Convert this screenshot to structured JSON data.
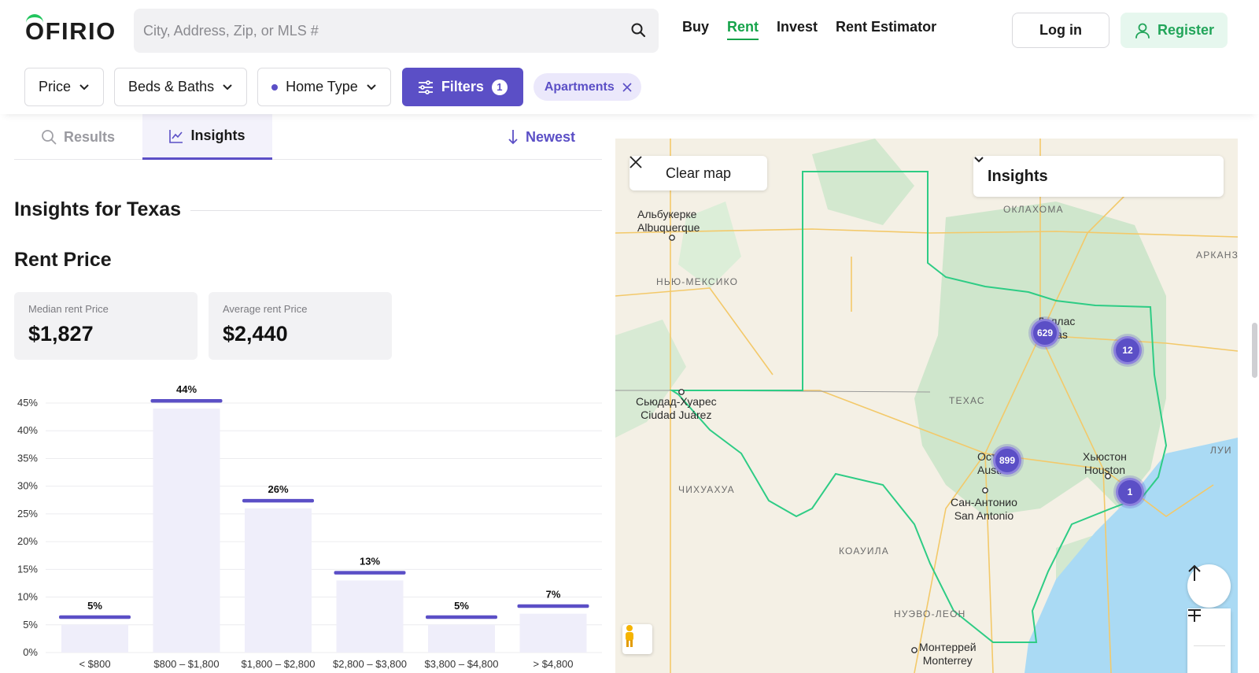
{
  "header": {
    "logo": "OFIRIO",
    "search_placeholder": "City, Address, Zip, or MLS #",
    "nav": [
      "Buy",
      "Rent",
      "Invest",
      "Rent Estimator"
    ],
    "active_nav": "Rent",
    "login": "Log in",
    "register": "Register"
  },
  "filters": {
    "price": "Price",
    "beds_baths": "Beds & Baths",
    "home_type": "Home Type",
    "filters_label": "Filters",
    "filters_count": "1",
    "chip": "Apartments"
  },
  "tabs": {
    "results": "Results",
    "insights": "Insights",
    "sort": "Newest"
  },
  "insights": {
    "title": "Insights for Texas",
    "section": "Rent Price",
    "median_label": "Median rent Price",
    "median_value": "$1,827",
    "average_label": "Average rent Price",
    "average_value": "$2,440"
  },
  "chart_data": {
    "type": "bar",
    "categories": [
      "< $800",
      "$800 – $1,800",
      "$1,800 – $2,800",
      "$2,800 – $3,800",
      "$3,800 – $4,800",
      "> $4,800"
    ],
    "values": [
      5,
      44,
      26,
      13,
      5,
      7
    ],
    "value_labels": [
      "5%",
      "44%",
      "26%",
      "13%",
      "5%",
      "7%"
    ],
    "y_ticks": [
      "0%",
      "5%",
      "10%",
      "15%",
      "20%",
      "25%",
      "30%",
      "35%",
      "40%",
      "45%"
    ],
    "ylim": [
      0,
      45
    ],
    "grid": true,
    "bar_color": "#efeefa",
    "cap_color": "#5b4fc6"
  },
  "map": {
    "clear_map": "Clear map",
    "dropdown": "Insights",
    "labels": {
      "albuquerque_ru": "Альбукерке",
      "albuquerque": "Albuquerque",
      "new_mexico": "НЬЮ-МЕКСИКО",
      "oklahoma": "ОКЛАХОМА",
      "arkansas": "АРКАНЗ",
      "dallas_ru": "Даллас",
      "dallas": "Dallas",
      "texas": "ТЕХАС",
      "juarez_ru": "Сьюдад-Хуарес",
      "juarez": "Ciudad Juárez",
      "austin_ru": "Остин",
      "austin": "Austin",
      "houston_ru": "Хьюстон",
      "houston": "Houston",
      "san_antonio_ru": "Сан-Антонио",
      "san_antonio": "San Antonio",
      "chihuahua": "ЧИХУАХУА",
      "coahuila": "КОАУИЛА",
      "nuevo_leon": "НУЭВО-ЛЕОН",
      "louisiana": "ЛУИ",
      "monterrey_ru": "Монтеррей",
      "monterrey": "Monterrey"
    },
    "markers": {
      "dallas": "629",
      "east_texas": "12",
      "austin": "899",
      "houston": "1"
    },
    "colors": {
      "land": "#f4f0e5",
      "green": "#cfe6cc",
      "water": "#aadaf4",
      "border": "#2ecc85",
      "roads": "#f3c96a"
    }
  }
}
